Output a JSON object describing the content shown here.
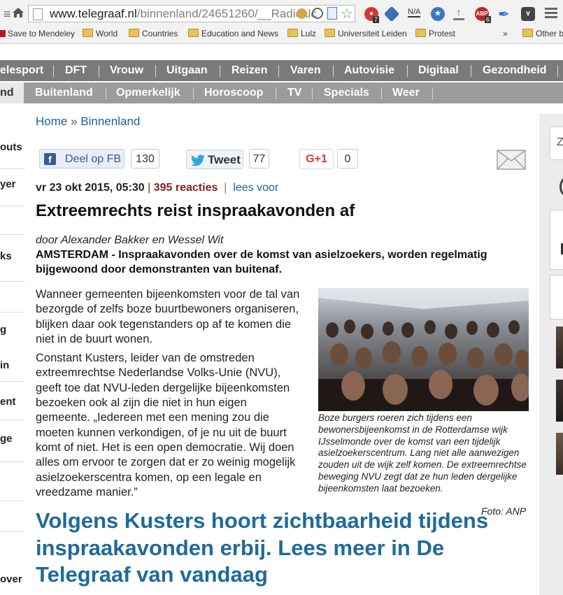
{
  "browser": {
    "url_host": "www.telegraaf.nl",
    "url_path": "/binnenland/24651260/__Radicalc",
    "bookmarks": [
      "Save to Mendeley",
      "World",
      "Countries",
      "Education and News",
      "Lulz",
      "Universiteit Leiden",
      "Protest",
      "»",
      "Other b"
    ],
    "extension_badges": [
      "7",
      "N/A",
      "6"
    ]
  },
  "nav_primary": [
    "elesport",
    "DFT",
    "Vrouw",
    "Uitgaan",
    "Reizen",
    "Varen",
    "Autovisie",
    "Digitaal",
    "Gezondheid"
  ],
  "nav_secondary": [
    "nd",
    "Buitenland",
    "Opmerkelijk",
    "Horoscoop",
    "TV",
    "Specials",
    "Weer"
  ],
  "left_sidebar": [
    "outs",
    "yer",
    "ks",
    "g",
    "in",
    "ent",
    "ge",
    "over"
  ],
  "breadcrumb": {
    "home": "Home",
    "separator": "»",
    "section": "Binnenland"
  },
  "social": {
    "fb_label": "Deel op FB",
    "fb_count": "130",
    "tweet_label": "Tweet",
    "tweet_count": "77",
    "gplus_label": "G+1",
    "gplus_count": "0"
  },
  "article": {
    "date": "vr 23 okt 2015, 05:30",
    "reactions": "395 reacties",
    "read_aloud": "lees voor",
    "headline": "Extreemrechts reist inspraakavonden af",
    "author": "door Alexander Bakker en Wessel Wit",
    "dateline": "AMSTERDAM -",
    "lead": "Inspraakavonden over de komst van asielzoekers, worden regelmatig bijgewoond door demonstranten van buitenaf.",
    "paragraph1": "Wanneer gemeenten bijeenkomsten voor de tal van bezorgde of zelfs boze buurtbewoners organiseren, blijken daar ook tegenstanders op af te komen die niet in de buurt wonen.",
    "paragraph2": "Constant Kusters, leider van de omstreden extreemrechtse Nederlandse Volks-Unie (NVU), geeft toe dat NVU-leden dergelijke bijeenkomsten bezoeken ook al zijn die niet in hun eigen gemeente. „Iedereen met een mening zou die moeten kunnen verkondigen, of je nu uit de buurt komt of niet. Het is een open democratie. Wij doen alles om ervoor te zorgen dat er zo weinig mogelijk asielzoekerscentra komen, op een legale en vreedzame manier.”",
    "caption": "Boze burgers roeren zich tijdens een bewonersbijeenkomst in de Rotterdamse wijk IJsselmonde over de komst van een tijdelijk asielzoekerscentrum. Lang niet alle aanwezigen zouden uit de wijk zelf komen. De extreemrechtse beweging NVU zegt dat ze hun leden dergelijke bijeenkomsten laat bezoeken.",
    "photo_credit": "Foto: ANP",
    "teaser": "Volgens Kusters hoort zichtbaarheid tijdens inspraakavonden erbij. Lees meer in De Telegraaf van vandaag"
  },
  "right_sidebar": {
    "search_letter": "Z"
  },
  "colors": {
    "link_blue": "#1f5f8b",
    "teaser_blue": "#1f6a9a",
    "reactions_red": "#8b1c1c",
    "nav_dark": "#7a7a7a",
    "nav_light": "#9c9c9c"
  }
}
